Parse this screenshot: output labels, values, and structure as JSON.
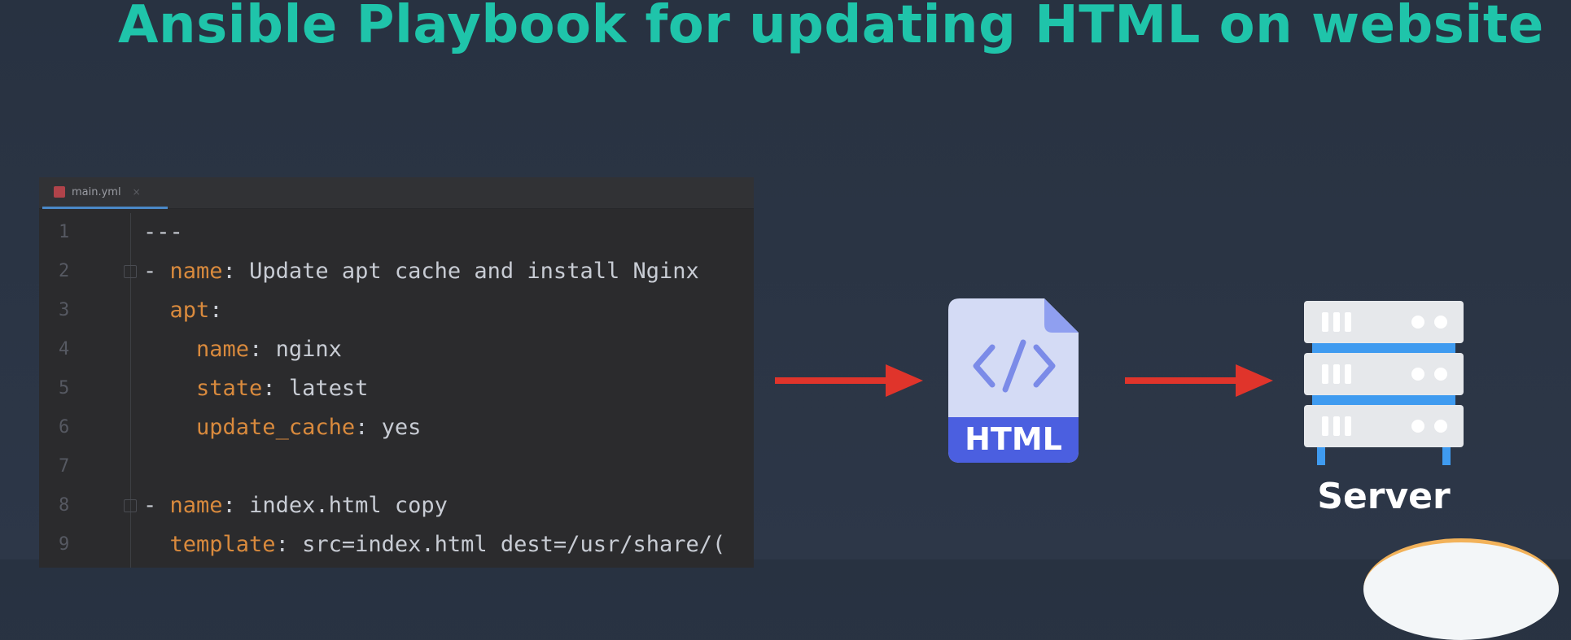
{
  "title": "Ansible Playbook for updating HTML on website",
  "editor": {
    "tab_label": "main.yml",
    "tab_close": "×",
    "lines": [
      {
        "n": "1",
        "key": "",
        "sep": "",
        "val": "---",
        "prefix": ""
      },
      {
        "n": "2",
        "prefix": "- ",
        "key": "name",
        "sep": ": ",
        "val": "Update apt cache and install Nginx"
      },
      {
        "n": "3",
        "prefix": "  ",
        "key": "apt",
        "sep": ":",
        "val": ""
      },
      {
        "n": "4",
        "prefix": "    ",
        "key": "name",
        "sep": ": ",
        "val": "nginx"
      },
      {
        "n": "5",
        "prefix": "    ",
        "key": "state",
        "sep": ": ",
        "val": "latest"
      },
      {
        "n": "6",
        "prefix": "    ",
        "key": "update_cache",
        "sep": ": ",
        "val": "yes"
      },
      {
        "n": "7",
        "prefix": "",
        "key": "",
        "sep": "",
        "val": ""
      },
      {
        "n": "8",
        "prefix": "- ",
        "key": "name",
        "sep": ": ",
        "val": "index.html copy"
      },
      {
        "n": "9",
        "prefix": "  ",
        "key": "template",
        "sep": ": ",
        "val": "src=index.html dest=/usr/share/("
      }
    ]
  },
  "diagram": {
    "html_label": "HTML",
    "server_label": "Server",
    "colors": {
      "arrow": "#e0342b",
      "html_blue": "#4b5fe0",
      "html_page": "#d4dbf5",
      "server_body": "#e6e8eb",
      "server_stripe": "#3f9bf0",
      "title": "#1fc4aa"
    }
  }
}
